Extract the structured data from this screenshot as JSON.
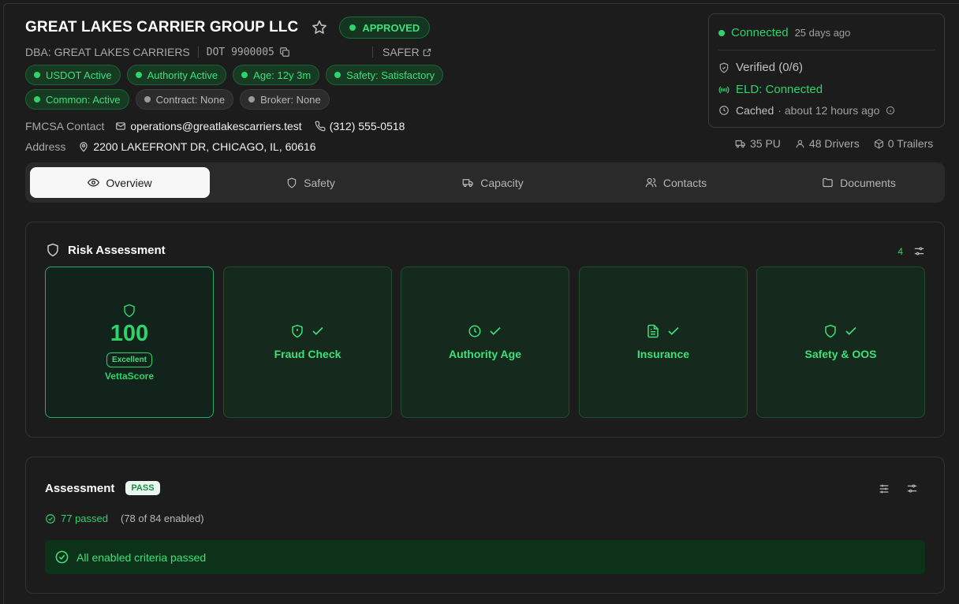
{
  "carrier": {
    "name": "GREAT LAKES CARRIER GROUP LLC",
    "status": "APPROVED",
    "dba": "DBA: GREAT LAKES CARRIERS",
    "dot": "DOT 9900005",
    "safer_label": "SAFER"
  },
  "badges_row1": [
    {
      "label": "USDOT Active"
    },
    {
      "label": "Authority Active"
    },
    {
      "label": "Age: 12y 3m"
    },
    {
      "label": "Safety: Satisfactory"
    }
  ],
  "badges_row2": [
    {
      "label": "Common: Active"
    },
    {
      "label": "Contract: None"
    },
    {
      "label": "Broker: None"
    }
  ],
  "contact": {
    "label": "FMCSA Contact",
    "email": "operations@greatlakescarriers.test",
    "phone": "(312) 555-0518",
    "address_label": "Address",
    "address": "2200 LAKEFRONT DR, CHICAGO, IL, 60616"
  },
  "status_card": {
    "connected": "Connected",
    "connected_ago": "25 days ago",
    "verified": "Verified (0/6)",
    "eld": "ELD: Connected",
    "cached": "Cached",
    "cached_ago": "· about 12 hours ago"
  },
  "fleet": {
    "power_units": "35 PU",
    "drivers": "48 Drivers",
    "trailers": "0 Trailers"
  },
  "tabs": [
    {
      "label": "Overview",
      "icon": "eye-icon"
    },
    {
      "label": "Safety",
      "icon": "shield-icon"
    },
    {
      "label": "Capacity",
      "icon": "truck-icon"
    },
    {
      "label": "Contacts",
      "icon": "users-icon"
    },
    {
      "label": "Documents",
      "icon": "folder-icon"
    }
  ],
  "risk": {
    "title": "Risk Assessment",
    "count": "4",
    "score": "100",
    "score_rating": "Excellent",
    "score_label": "VettaScore",
    "checks": [
      {
        "label": "Fraud Check",
        "icon": "shield-alert-icon"
      },
      {
        "label": "Authority Age",
        "icon": "clock-icon"
      },
      {
        "label": "Insurance",
        "icon": "file-text-icon"
      },
      {
        "label": "Safety & OOS",
        "icon": "shield-icon"
      }
    ]
  },
  "assessment": {
    "title": "Assessment",
    "result": "PASS",
    "passed": "77 passed",
    "enabled": "(78 of 84 enabled)",
    "summary": "All enabled criteria passed"
  },
  "colors": {
    "accent_green": "#2ed36b",
    "background": "#1c1c1c"
  }
}
